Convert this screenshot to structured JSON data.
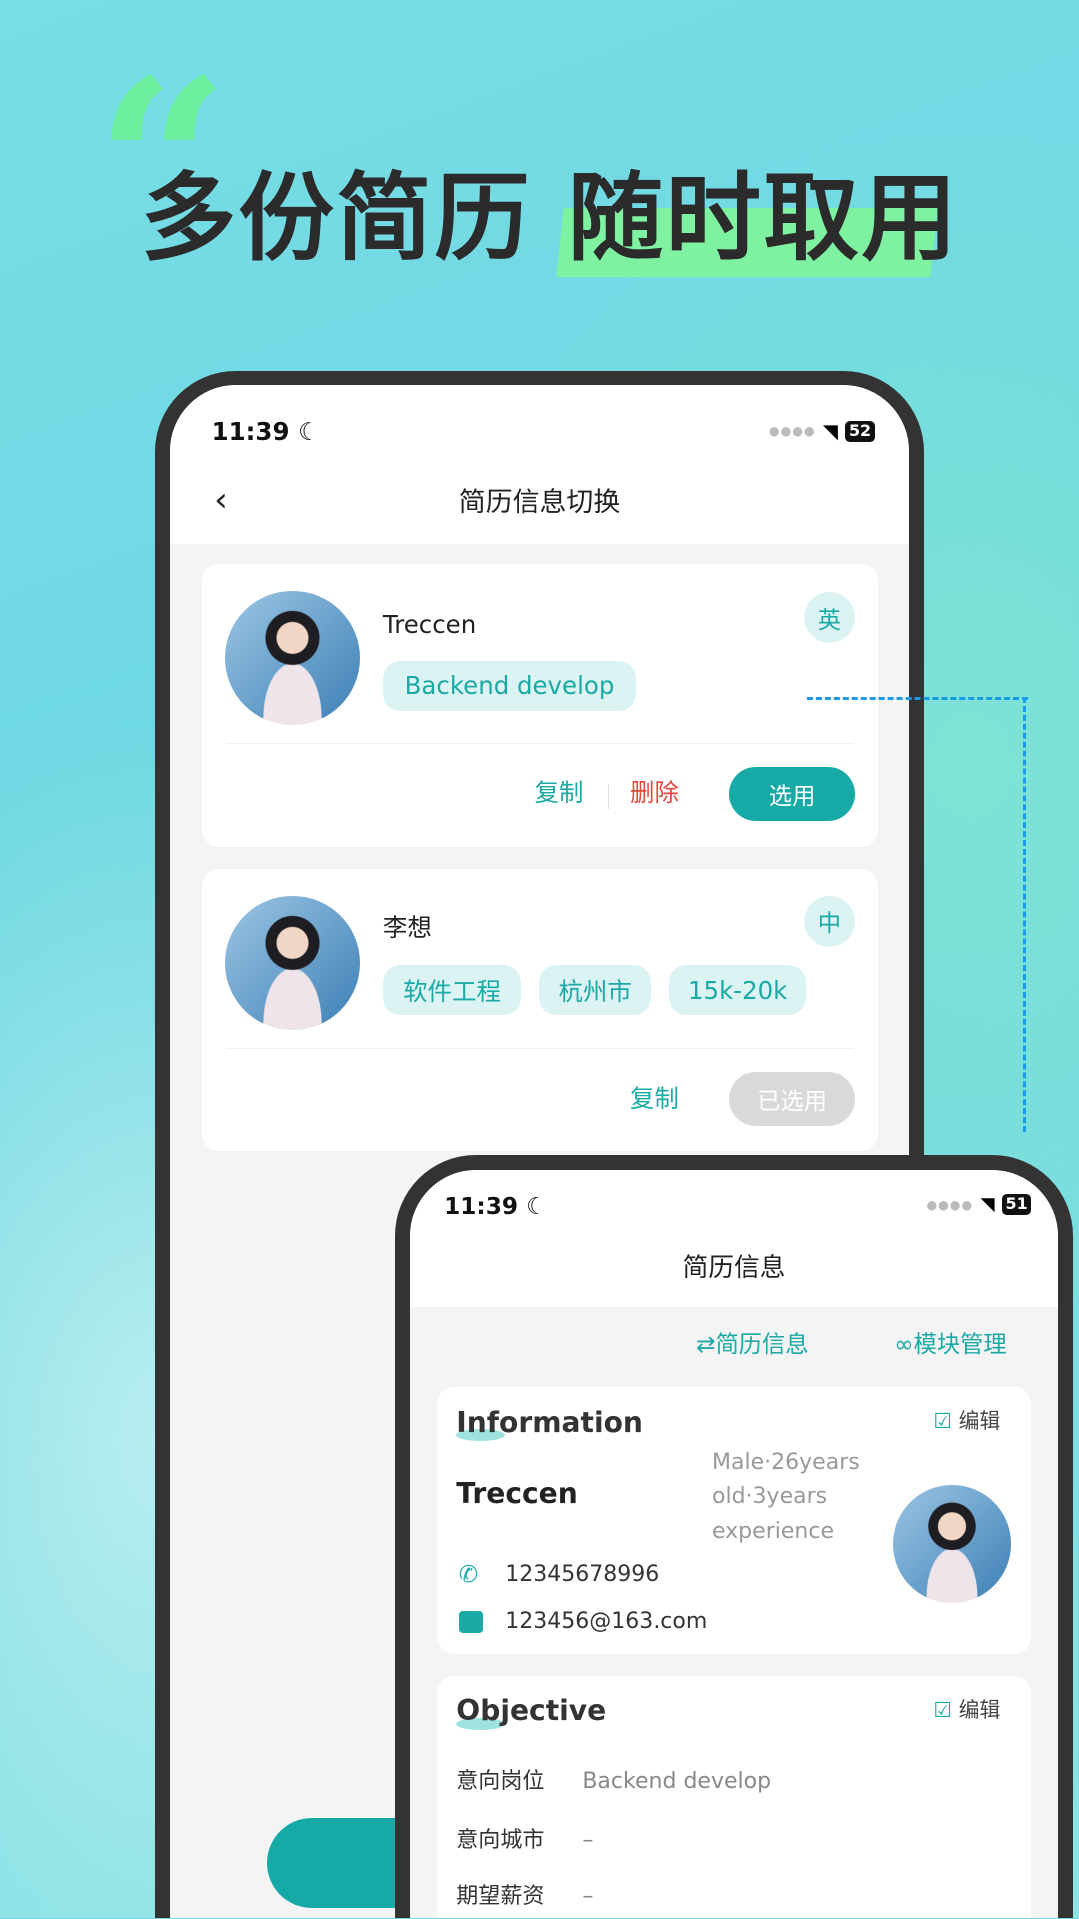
{
  "headline": {
    "quote_mark": "“",
    "part1": "多份简历",
    "part2": "随时取用"
  },
  "colors": {
    "accent": "#16aaa6",
    "delete": "#e8453c",
    "highlight": "#7ff2a2",
    "connector": "#1a9be8"
  },
  "phone1": {
    "status": {
      "time": "11:39",
      "battery": "52"
    },
    "nav": {
      "back_icon": "chevron-left",
      "title": "简历信息切换"
    },
    "resumes": [
      {
        "name": "Treccen",
        "tags": [
          "Backend develop"
        ],
        "language": "英",
        "actions": {
          "copy": "复制",
          "delete": "删除",
          "select": "选用"
        }
      },
      {
        "name": "李想",
        "tags": [
          "软件工程",
          "杭州市",
          "15k-20k"
        ],
        "language": "中",
        "actions": {
          "copy": "复制",
          "selected": "已选用"
        }
      }
    ]
  },
  "phone2": {
    "status": {
      "time": "11:39",
      "battery": "51"
    },
    "nav": {
      "title": "简历信息"
    },
    "toolbar": {
      "resume_info": "简历信息",
      "module_manage": "模块管理"
    },
    "information": {
      "heading": "Information",
      "edit": "编辑",
      "name": "Treccen",
      "meta": [
        "Male·26years",
        "old·3years",
        "experience"
      ],
      "phone": "12345678996",
      "email": "123456@163.com"
    },
    "objective": {
      "heading": "Objective",
      "edit": "编辑",
      "rows": [
        {
          "label": "意向岗位",
          "value": "Backend develop"
        },
        {
          "label": "意向城市",
          "value": "–"
        },
        {
          "label": "期望薪资",
          "value": "–"
        }
      ]
    }
  }
}
